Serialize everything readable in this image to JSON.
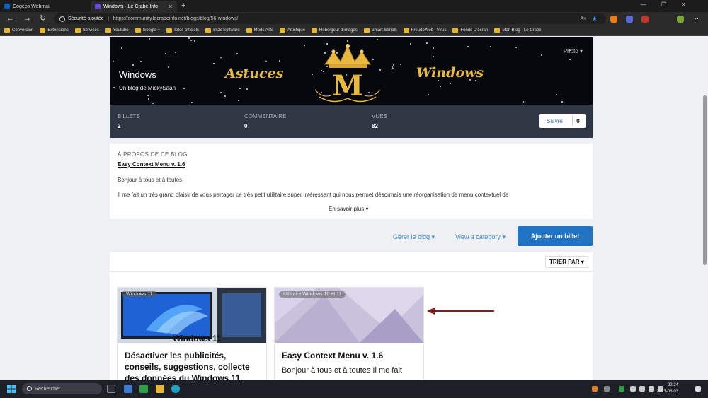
{
  "browser": {
    "tabs": [
      {
        "label": "Cogeco Webmail",
        "active": false
      },
      {
        "label": "Windows - Le Crabe Info",
        "active": true
      }
    ],
    "security_label": "Sécurité ajoutée",
    "url": "https://community.lecrabeinfo.net/blogs/blog/56-windows/",
    "bookmarks": [
      "Conversion",
      "Extensions",
      "Services",
      "Youtube",
      "Google +",
      "Sites officiels",
      "SCS Software",
      "Mods ATS",
      "Artistique",
      "Hébergeur d'images",
      "Smart Serials",
      "FreudeWeb | Virus",
      "Fonds D'écran",
      "Mon Blog - Le Crabe"
    ]
  },
  "banner": {
    "blog_name": "Windows",
    "subtitle": "Un blog de MickySaan",
    "left_word": "Astuces",
    "right_word": "Windows",
    "crown_letter": "M",
    "photo_button": "Photo ▾"
  },
  "stats": [
    {
      "label": "BILLETS",
      "value": "2"
    },
    {
      "label": "COMMENTAIRE",
      "value": "0"
    },
    {
      "label": "VUES",
      "value": "82"
    }
  ],
  "follow": {
    "label": "Suivre",
    "count": "0"
  },
  "about": {
    "heading": "À PROPOS DE CE BLOG",
    "link": "Easy Context Menu v. 1.6",
    "p1": "Bonjour à tous et à toutes",
    "p2": "Il me fait un très grand plaisir de vous partager ce très petit utilitaire super intéressant qui nous permet désormais une réorganisation de menu contextuel de",
    "more": "En savoir plus ▾"
  },
  "actions": {
    "manage": "Gérer le blog ▾",
    "category": "View a category ▾",
    "add": "Ajouter un billet"
  },
  "sort_label": "TRIER PAR ▾",
  "cards": [
    {
      "tag": "Windows 11",
      "title": "Désactiver les publicités, conseils, suggestions, collecte des données du Windows 11",
      "excerpt": "",
      "thumb_text": "Windows 11"
    },
    {
      "tag": "Utilitaire Windows 10 et 11",
      "title": "Easy Context Menu v. 1.6",
      "excerpt": "Bonjour à tous et à toutes Il me fait",
      "thumb_text": ""
    }
  ],
  "taskbar": {
    "search_placeholder": "Rechercher",
    "time": "22:34",
    "date": "2023-06-03"
  },
  "colors": {
    "accent": "#1f73c2",
    "gold": "#e8b93c",
    "arrow": "#8b1a1a"
  }
}
